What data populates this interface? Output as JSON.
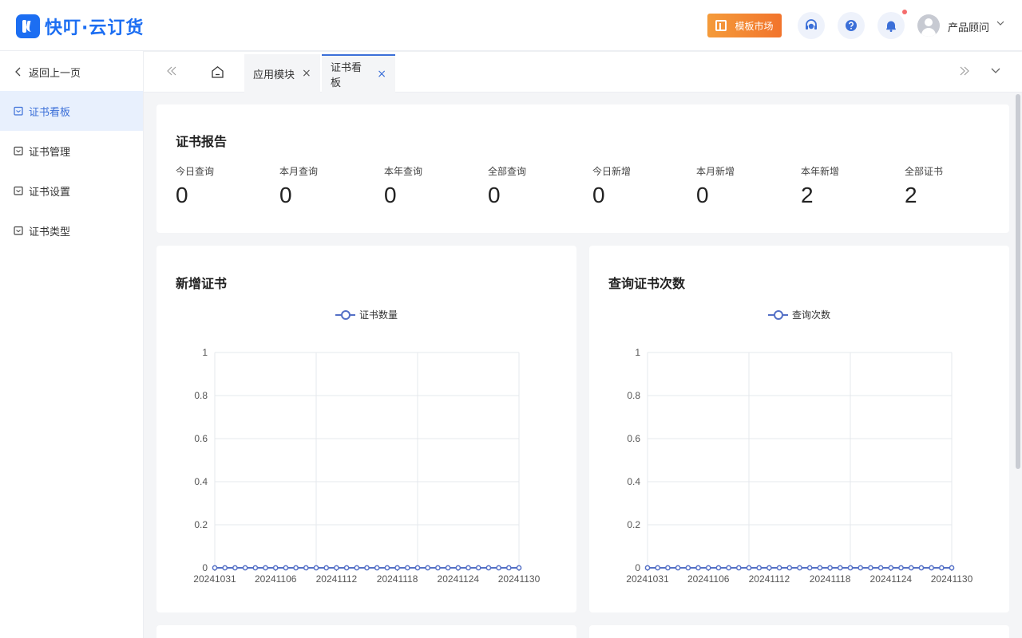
{
  "header": {
    "logo_text": "快叮·云订货",
    "market_label": "模板市场",
    "user_name": "产品顾问",
    "icons": [
      "customer-service-icon",
      "help-icon",
      "bell-icon"
    ]
  },
  "sidebar": {
    "back_label": "返回上一页",
    "items": [
      {
        "label": "证书看板",
        "active": true
      },
      {
        "label": "证书管理",
        "active": false
      },
      {
        "label": "证书设置",
        "active": false
      },
      {
        "label": "证书类型",
        "active": false
      }
    ]
  },
  "tabs": [
    {
      "label": "应用模块",
      "active": false
    },
    {
      "label": "证书看板",
      "active": true
    }
  ],
  "report": {
    "title": "证书报告",
    "stats": [
      {
        "label": "今日查询",
        "value": "0"
      },
      {
        "label": "本月查询",
        "value": "0"
      },
      {
        "label": "本年查询",
        "value": "0"
      },
      {
        "label": "全部查询",
        "value": "0"
      },
      {
        "label": "今日新增",
        "value": "0"
      },
      {
        "label": "本月新增",
        "value": "0"
      },
      {
        "label": "本年新增",
        "value": "2"
      },
      {
        "label": "全部证书",
        "value": "2"
      }
    ]
  },
  "chart_data": [
    {
      "type": "line",
      "title": "新增证书",
      "xlabel": "",
      "ylabel": "",
      "categories": [
        "20241031",
        "20241101",
        "20241102",
        "20241103",
        "20241104",
        "20241105",
        "20241106",
        "20241107",
        "20241108",
        "20241109",
        "20241110",
        "20241111",
        "20241112",
        "20241113",
        "20241114",
        "20241115",
        "20241116",
        "20241117",
        "20241118",
        "20241119",
        "20241120",
        "20241121",
        "20241122",
        "20241123",
        "20241124",
        "20241125",
        "20241126",
        "20241127",
        "20241128",
        "20241129",
        "20241130"
      ],
      "x_tick_labels": [
        "20241031",
        "20241106",
        "20241112",
        "20241118",
        "20241124",
        "20241130"
      ],
      "y_tick_labels": [
        "0",
        "0.2",
        "0.4",
        "0.6",
        "0.8",
        "1"
      ],
      "ylim": [
        0,
        1
      ],
      "grid": true,
      "legend_position": "top",
      "series": [
        {
          "name": "证书数量",
          "values": [
            0,
            0,
            0,
            0,
            0,
            0,
            0,
            0,
            0,
            0,
            0,
            0,
            0,
            0,
            0,
            0,
            0,
            0,
            0,
            0,
            0,
            0,
            0,
            0,
            0,
            0,
            0,
            0,
            0,
            0,
            0
          ]
        }
      ]
    },
    {
      "type": "line",
      "title": "查询证书次数",
      "xlabel": "",
      "ylabel": "",
      "categories": [
        "20241031",
        "20241101",
        "20241102",
        "20241103",
        "20241104",
        "20241105",
        "20241106",
        "20241107",
        "20241108",
        "20241109",
        "20241110",
        "20241111",
        "20241112",
        "20241113",
        "20241114",
        "20241115",
        "20241116",
        "20241117",
        "20241118",
        "20241119",
        "20241120",
        "20241121",
        "20241122",
        "20241123",
        "20241124",
        "20241125",
        "20241126",
        "20241127",
        "20241128",
        "20241129",
        "20241130"
      ],
      "x_tick_labels": [
        "20241031",
        "20241106",
        "20241112",
        "20241118",
        "20241124",
        "20241130"
      ],
      "y_tick_labels": [
        "0",
        "0.2",
        "0.4",
        "0.6",
        "0.8",
        "1"
      ],
      "ylim": [
        0,
        1
      ],
      "grid": true,
      "legend_position": "top",
      "series": [
        {
          "name": "查询次数",
          "values": [
            0,
            0,
            0,
            0,
            0,
            0,
            0,
            0,
            0,
            0,
            0,
            0,
            0,
            0,
            0,
            0,
            0,
            0,
            0,
            0,
            0,
            0,
            0,
            0,
            0,
            0,
            0,
            0,
            0,
            0,
            0
          ]
        }
      ]
    }
  ],
  "colors": {
    "accent": "#3b6fd8",
    "brand": "#1c6ef2",
    "series": "#5470c6",
    "market": "#f2742c"
  }
}
